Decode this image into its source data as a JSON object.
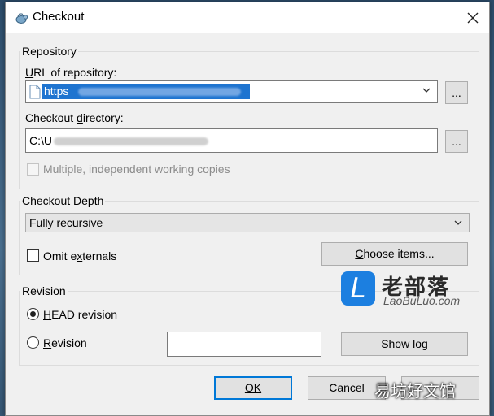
{
  "window": {
    "title": "Checkout",
    "title_icon": "tortoise-svn-icon",
    "close_glyph": "✕"
  },
  "repository": {
    "group_label": "Repository",
    "url_label_pre": "",
    "url_label_ul": "U",
    "url_label_post": "RL of repository:",
    "url_value": "https",
    "browse_label": "...",
    "dir_label_pre": "Checkout ",
    "dir_label_ul": "d",
    "dir_label_post": "irectory:",
    "dir_value": "C:\\U",
    "dir_browse_label": "...",
    "multiple_label": "Multiple, independent working copies"
  },
  "depth": {
    "group_label": "Checkout Depth",
    "selected": "Fully recursive",
    "omit_pre": "Omit e",
    "omit_ul": "x",
    "omit_post": "ternals",
    "choose_pre": "",
    "choose_ul": "C",
    "choose_post": "hoose items..."
  },
  "revision": {
    "group_label": "Revision",
    "head_pre": "",
    "head_ul": "H",
    "head_post": "EAD revision",
    "rev_pre": "",
    "rev_ul": "R",
    "rev_post": "evision",
    "rev_value": "",
    "showlog_pre": "Show ",
    "showlog_ul": "l",
    "showlog_post": "og"
  },
  "footer": {
    "ok_label": "OK",
    "cancel_label": "Cancel"
  },
  "watermark": {
    "logo_glyph": "L",
    "cn": "老部落",
    "en": "LaoBuLuo.com",
    "bottom": "易坊好文馆"
  },
  "colors": {
    "selection": "#1e74d0",
    "logo": "#1c7fe0"
  }
}
